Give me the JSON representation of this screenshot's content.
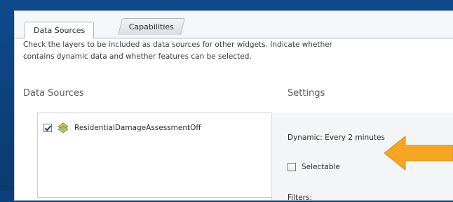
{
  "tabs": [
    {
      "label": "Data Sources",
      "active": true
    },
    {
      "label": "Capabilities",
      "active": false
    }
  ],
  "description": {
    "line1": "Check the layers to be included as data sources for other widgets. Indicate whether",
    "line2": "contains dynamic data and whether features can be selected."
  },
  "columns": {
    "data_sources": "Data Sources",
    "settings": "Settings"
  },
  "layers": [
    {
      "label": "ResidentialDamageAssessmentOff",
      "checked": true,
      "icon": "layer-icon"
    }
  ],
  "settings": {
    "dynamic": "Dynamic: Every 2 minutes",
    "selectable_label": "Selectable",
    "selectable_checked": false,
    "filters_label": "Filters:"
  },
  "colors": {
    "background": "#0d3f7a",
    "arrow": "#f6a623"
  }
}
